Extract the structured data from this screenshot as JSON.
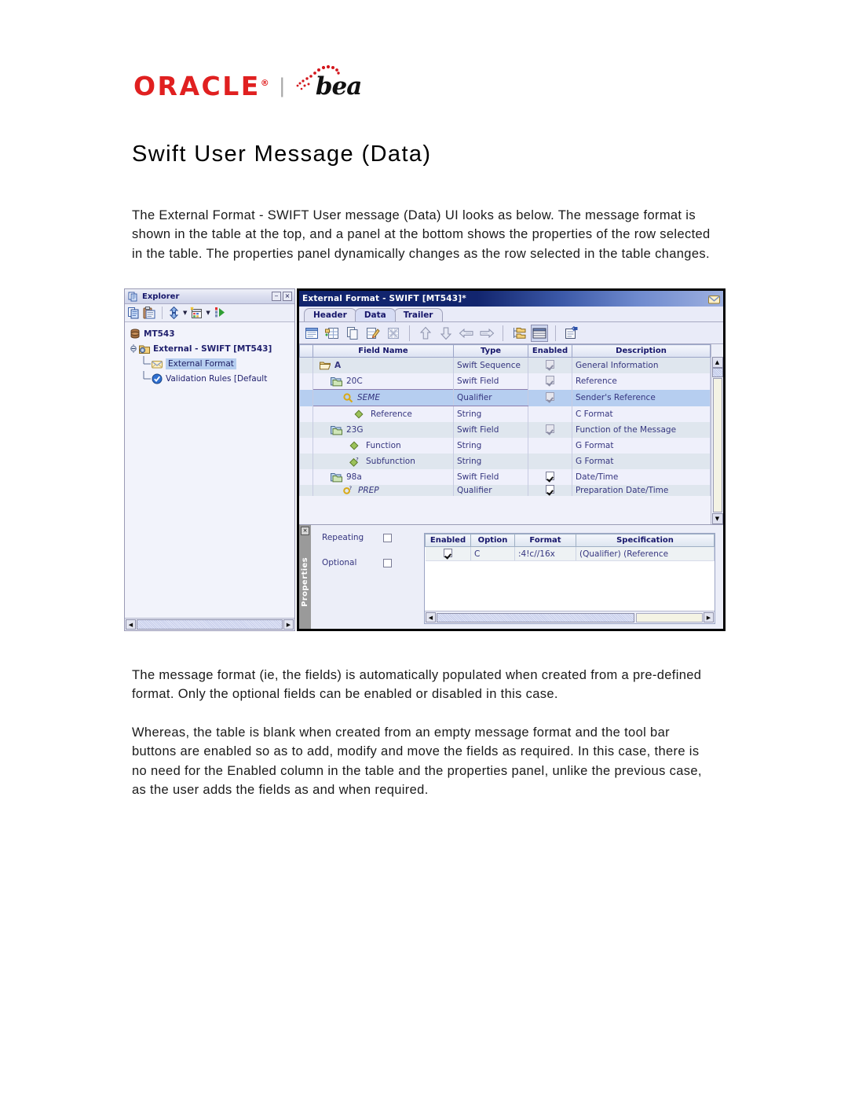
{
  "document": {
    "logo": {
      "oracle": "ORACLE",
      "registered": "®",
      "separator": "|",
      "bea": "bea"
    },
    "title": "Swift User Message (Data)",
    "paragraphs": [
      "The External Format - SWIFT User message (Data) UI looks as below. The message format is shown in the table at the top, and a panel at the bottom shows the properties of the row selected in the table. The properties panel dynamically changes as the row selected in the table changes.",
      "The message format (ie, the fields) is automatically populated when created from a pre-defined format. Only the optional fields can be enabled or disabled in this case.",
      "Whereas, the table is blank when created from an empty message format and the tool bar buttons are enabled so as to add, modify and move the fields as required. In this case, there is no need for the Enabled column in the table and the properties panel, unlike the previous case, as the user adds the fields as and when required."
    ]
  },
  "screenshot": {
    "explorer": {
      "title": "Explorer",
      "title_icon": "document-pages-icon",
      "window_buttons": [
        {
          "name": "auto-hide-pin-button",
          "glyph": "⎯"
        },
        {
          "name": "close-panel-button",
          "glyph": "×"
        }
      ],
      "toolbar": [
        {
          "name": "copy-icon"
        },
        {
          "name": "paste-icon"
        },
        {
          "name": "refresh-sync-icon",
          "has_dropdown": true
        },
        {
          "name": "new-item-icon",
          "has_dropdown": true
        },
        {
          "name": "run-deploy-icon"
        }
      ],
      "tree": [
        {
          "label": "MT543",
          "icon": "database-icon",
          "indent": 0,
          "bold": true,
          "selected": false
        },
        {
          "label": "External - SWIFT [MT543]",
          "icon": "external-format-folder-icon",
          "indent": 1,
          "bold": true,
          "selected": false,
          "expander": "minus"
        },
        {
          "label": "External Format",
          "icon": "envelope-icon",
          "indent": 2,
          "bold": false,
          "selected": true
        },
        {
          "label": "Validation Rules [Default",
          "icon": "check-badge-icon",
          "indent": 2,
          "bold": false,
          "selected": false
        }
      ]
    },
    "main_window": {
      "title": "External Format - SWIFT [MT543]*",
      "title_icon": "envelope-icon",
      "tabs": [
        {
          "label": "Header",
          "active": false
        },
        {
          "label": "Data",
          "active": true
        },
        {
          "label": "Trailer",
          "active": false
        }
      ],
      "toolbar": [
        {
          "name": "new-message-format-icon"
        },
        {
          "name": "insert-row-icon"
        },
        {
          "name": "copy-page-icon"
        },
        {
          "name": "edit-row-icon"
        },
        {
          "name": "delete-row-icon"
        },
        {
          "name": "move-up-icon"
        },
        {
          "name": "move-down-icon"
        },
        {
          "name": "move-left-icon"
        },
        {
          "name": "move-right-icon"
        },
        {
          "name": "expand-tree-icon"
        },
        {
          "name": "show-grid-icon",
          "pressed": true
        },
        {
          "name": "properties-icon"
        }
      ],
      "table": {
        "columns": [
          "Field Name",
          "Type",
          "Enabled",
          "Description"
        ],
        "rows": [
          {
            "name": "A",
            "indent": 0,
            "icon": "open-folder-icon",
            "type": "Swift Sequence",
            "enabled": true,
            "enabled_disabled": true,
            "description": "General Information",
            "italic": false,
            "bold": true,
            "selected": false
          },
          {
            "name": "20C",
            "indent": 1,
            "icon": "swift-field-icon",
            "type": "Swift Field",
            "enabled": true,
            "enabled_disabled": true,
            "description": "Reference",
            "italic": false,
            "bold": false,
            "selected": false
          },
          {
            "name": "SEME",
            "indent": 2,
            "icon": "qualifier-icon",
            "type": "Qualifier",
            "enabled": true,
            "enabled_disabled": true,
            "description": "Sender's Reference",
            "italic": true,
            "bold": false,
            "selected": true
          },
          {
            "name": "Reference",
            "indent": 3,
            "icon": "string-diamond-icon",
            "type": "String",
            "enabled": null,
            "enabled_disabled": false,
            "description": "C Format",
            "italic": false,
            "bold": false,
            "selected": false
          },
          {
            "name": "23G",
            "indent": 1,
            "icon": "swift-field-icon",
            "type": "Swift Field",
            "enabled": true,
            "enabled_disabled": true,
            "description": "Function of the Message",
            "italic": false,
            "bold": false,
            "selected": false
          },
          {
            "name": "Function",
            "indent": 3,
            "icon": "string-diamond-icon",
            "type": "String",
            "enabled": null,
            "enabled_disabled": false,
            "description": "G Format",
            "italic": false,
            "bold": false,
            "selected": false
          },
          {
            "name": "Subfunction",
            "indent": 3,
            "icon": "optional-diamond-icon",
            "type": "String",
            "enabled": null,
            "enabled_disabled": false,
            "description": "G Format",
            "italic": false,
            "bold": false,
            "selected": false
          },
          {
            "name": "98a",
            "indent": 1,
            "icon": "swift-field-icon",
            "type": "Swift Field",
            "enabled": true,
            "enabled_disabled": false,
            "description": "Date/Time",
            "italic": false,
            "bold": false,
            "selected": false
          },
          {
            "name": "PREP",
            "indent": 2,
            "icon": "optional-qualifier-icon",
            "type": "Qualifier",
            "enabled": true,
            "enabled_disabled": false,
            "description": "Preparation Date/Time",
            "italic": true,
            "bold": false,
            "selected": false
          }
        ]
      },
      "properties_panel": {
        "tab_label": "Properties",
        "close_glyph": "×",
        "checkboxes": [
          {
            "label": "Repeating",
            "checked": false
          },
          {
            "label": "Optional",
            "checked": false
          }
        ],
        "table": {
          "columns": [
            "Enabled",
            "Option",
            "Format",
            "Specification"
          ],
          "rows": [
            {
              "enabled": true,
              "option": "C",
              "format": ":4!c//16x",
              "specification": "(Qualifier) (Reference"
            }
          ]
        }
      }
    }
  },
  "colors": {
    "oracle_red": "#e02020",
    "title_bar_blue": "#12256e",
    "selection_blue": "#b6cef0",
    "grid_text": "#35357f",
    "header_text": "#16166a"
  }
}
